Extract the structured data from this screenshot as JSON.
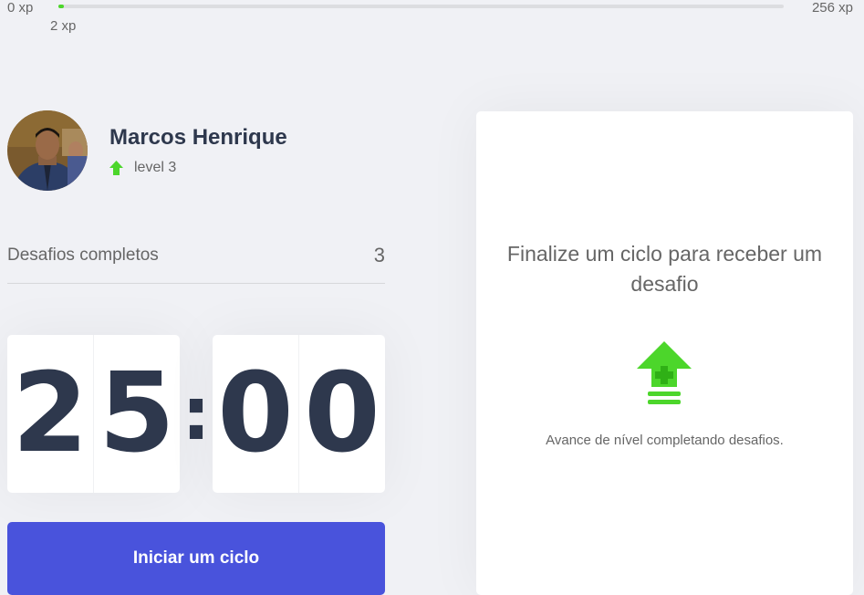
{
  "experience": {
    "min_label": "0 xp",
    "max_label": "256 xp",
    "current_label": "2 xp",
    "current": 2,
    "max": 256,
    "fill_color": "#4cd62b"
  },
  "profile": {
    "name": "Marcos Henrique",
    "level_label": "level 3",
    "level_icon": "level-up-arrow-icon"
  },
  "challenges": {
    "completed_label": "Desafios completos",
    "completed_count": "3"
  },
  "countdown": {
    "minute_left": "2",
    "minute_right": "5",
    "separator": ":",
    "second_left": "0",
    "second_right": "0"
  },
  "start_button": {
    "label": "Iniciar um ciclo",
    "color": "#4953dc"
  },
  "challenge_box": {
    "title": "Finalize um ciclo para receber um desafio",
    "icon": "level-up-icon",
    "hint": "Avance de nível completando desafios."
  }
}
